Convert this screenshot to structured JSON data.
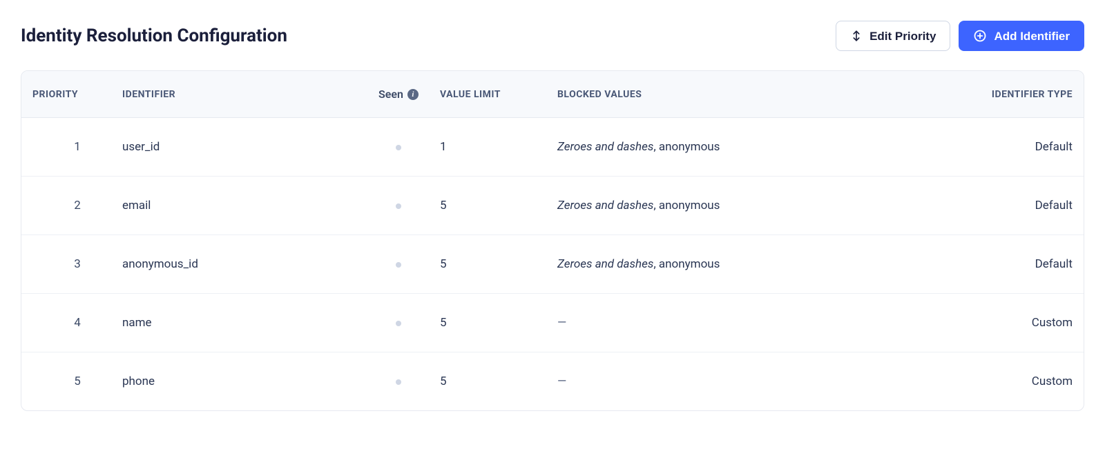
{
  "page": {
    "title": "Identity Resolution Configuration"
  },
  "actions": {
    "edit_priority_label": "Edit Priority",
    "add_identifier_label": "Add Identifier"
  },
  "table": {
    "headers": {
      "priority": "PRIORITY",
      "identifier": "IDENTIFIER",
      "seen": "Seen",
      "value_limit": "VALUE LIMIT",
      "blocked_values": "BLOCKED VALUES",
      "identifier_type": "IDENTIFIER TYPE"
    },
    "rows": [
      {
        "priority": "1",
        "identifier": "user_id",
        "seen": false,
        "value_limit": "1",
        "blocked_italic": "Zeroes and dashes",
        "blocked_rest": ", anonymous",
        "blocked_dash": "",
        "identifier_type": "Default"
      },
      {
        "priority": "2",
        "identifier": "email",
        "seen": false,
        "value_limit": "5",
        "blocked_italic": "Zeroes and dashes",
        "blocked_rest": ", anonymous",
        "blocked_dash": "",
        "identifier_type": "Default"
      },
      {
        "priority": "3",
        "identifier": "anonymous_id",
        "seen": false,
        "value_limit": "5",
        "blocked_italic": "Zeroes and dashes",
        "blocked_rest": ", anonymous",
        "blocked_dash": "",
        "identifier_type": "Default"
      },
      {
        "priority": "4",
        "identifier": "name",
        "seen": false,
        "value_limit": "5",
        "blocked_italic": "",
        "blocked_rest": "",
        "blocked_dash": "—",
        "identifier_type": "Custom"
      },
      {
        "priority": "5",
        "identifier": "phone",
        "seen": false,
        "value_limit": "5",
        "blocked_italic": "",
        "blocked_rest": "",
        "blocked_dash": "—",
        "identifier_type": "Custom"
      }
    ]
  }
}
